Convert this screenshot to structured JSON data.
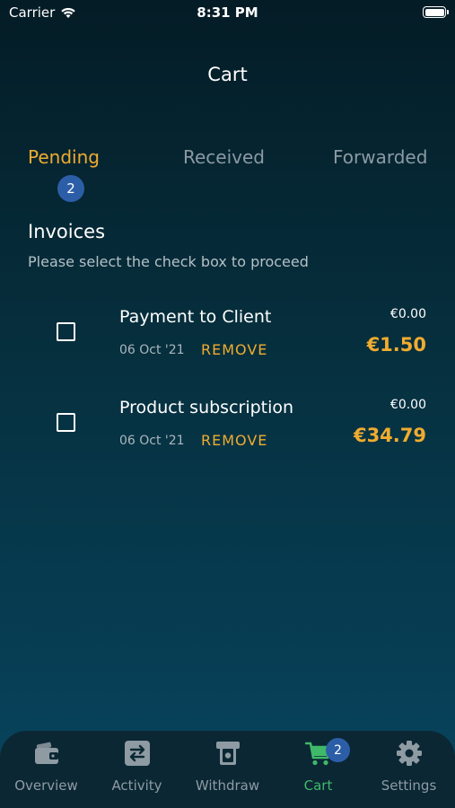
{
  "status_bar": {
    "carrier": "Carrier",
    "time": "8:31 PM"
  },
  "header": {
    "title": "Cart"
  },
  "tabs": [
    {
      "label": "Pending",
      "active": true
    },
    {
      "label": "Received",
      "active": false
    },
    {
      "label": "Forwarded",
      "active": false
    }
  ],
  "pending_count": "2",
  "section": {
    "title": "Invoices",
    "subtitle": "Please select the check box to proceed"
  },
  "invoices": [
    {
      "name": "Payment to Client",
      "date": "06 Oct '21",
      "remove_label": "REMOVE",
      "small_amount": "€0.00",
      "amount": "€1.50",
      "checked": false
    },
    {
      "name": "Product subscription",
      "date": "06 Oct '21",
      "remove_label": "REMOVE",
      "small_amount": "€0.00",
      "amount": "€34.79",
      "checked": false
    }
  ],
  "tabbar": {
    "items": [
      {
        "label": "Overview",
        "icon": "wallet-icon",
        "active": false
      },
      {
        "label": "Activity",
        "icon": "transfer-arrows-icon",
        "active": false
      },
      {
        "label": "Withdraw",
        "icon": "atm-withdraw-icon",
        "active": false
      },
      {
        "label": "Cart",
        "icon": "cart-icon",
        "active": true
      },
      {
        "label": "Settings",
        "icon": "gear-icon",
        "active": false
      }
    ],
    "cart_badge": "2"
  },
  "colors": {
    "accent": "#f0ac2f",
    "active_tab_green": "#40b86a",
    "badge_blue": "#2c5ea8",
    "inactive_gray": "#8e9ba3"
  }
}
